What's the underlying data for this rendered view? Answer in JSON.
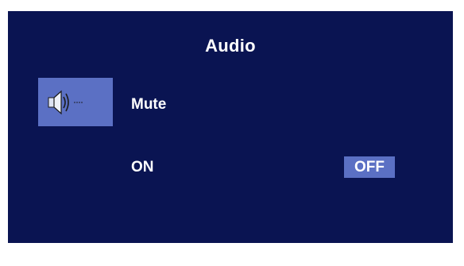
{
  "osd": {
    "title": "Audio",
    "selected_icon": "speaker-icon",
    "item_label": "Mute",
    "options": [
      {
        "label": "ON",
        "selected": false
      },
      {
        "label": "OFF",
        "selected": true
      }
    ],
    "colors": {
      "background": "#0a1452",
      "highlight": "#5b70c4",
      "text": "#ffffff"
    }
  }
}
